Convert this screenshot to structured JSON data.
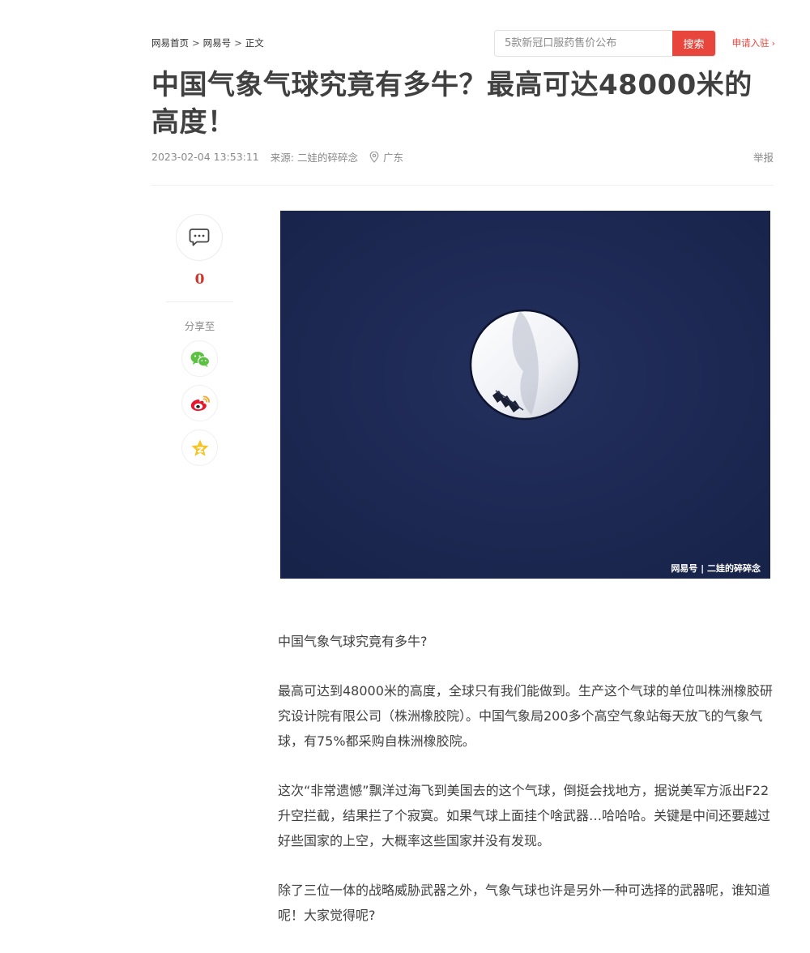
{
  "breadcrumb": {
    "home": "网易首页",
    "section": "网易号",
    "current": "正文",
    "separator": ">"
  },
  "search": {
    "placeholder": "5款新冠口服药售价公布",
    "button_label": "搜索"
  },
  "apply_link": "申请入驻",
  "article": {
    "title": "中国气象气球究竟有多牛？最高可达48000米的高度！",
    "datetime": "2023-02-04 13:53:11",
    "source": "来源: 二娃的碎碎念",
    "location": "广东",
    "report_label": "举报",
    "image_watermark": "网易号 | 二娃的碎碎念",
    "paragraphs": [
      "中国气象气球究竟有多牛?",
      "最高可达到48000米的高度，全球只有我们能做到。生产这个气球的单位叫株洲橡胶研究设计院有限公司（株洲橡胶院）。中国气象局200多个高空气象站每天放飞的气象气球，有75%都采购自株洲橡胶院。",
      "这次“非常遗憾”飘洋过海飞到美国去的这个气球，倒挺会找地方，据说美军方派出F22升空拦截，结果拦了个寂寞。如果气球上面挂个啥武器…哈哈哈。关键是中间还要越过好些国家的上空，大概率这些国家并没有发现。",
      "除了三位一体的战略威胁武器之外，气象气球也许是另外一种可选择的武器呢，谁知道呢！大家觉得呢?"
    ]
  },
  "sidebar": {
    "comment_count": "0",
    "share_label": "分享至",
    "share_targets": [
      "wechat-icon",
      "weibo-icon",
      "qzone-icon"
    ]
  },
  "colors": {
    "accent": "#e8463c",
    "comment_count": "#d0352b",
    "sky": "#1d2a55"
  }
}
